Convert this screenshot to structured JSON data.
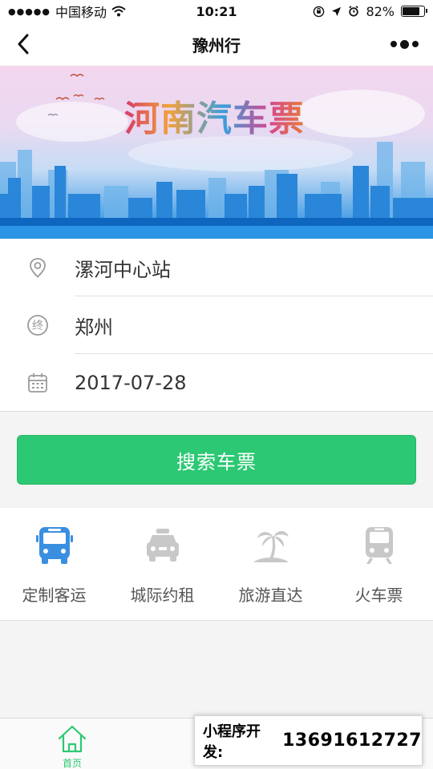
{
  "status_bar": {
    "carrier": "中国移动",
    "time": "10:21",
    "battery": "82%",
    "battery_level": 0.82
  },
  "nav": {
    "title": "豫州行"
  },
  "banner": {
    "title": "河南汽车票"
  },
  "form": {
    "origin": "漯河中心站",
    "destination": "郑州",
    "destination_icon_char": "终",
    "date": "2017-07-28"
  },
  "search_button": {
    "label": "搜索车票"
  },
  "services": [
    {
      "label": "定制客运",
      "icon": "bus-icon",
      "active": true
    },
    {
      "label": "城际约租",
      "icon": "taxi-icon",
      "active": false
    },
    {
      "label": "旅游直达",
      "icon": "palm-tree-icon",
      "active": false
    },
    {
      "label": "火车票",
      "icon": "train-icon",
      "active": false
    }
  ],
  "tabbar": {
    "tabs": [
      {
        "label": "首页",
        "icon": "home-icon",
        "active": true
      }
    ]
  },
  "watermark": {
    "label": "小程序开发:",
    "phone": "13691612727"
  },
  "colors": {
    "accent": "#2cc873",
    "service_active": "#3a8fe0",
    "service_inactive": "#c8c8c8"
  }
}
